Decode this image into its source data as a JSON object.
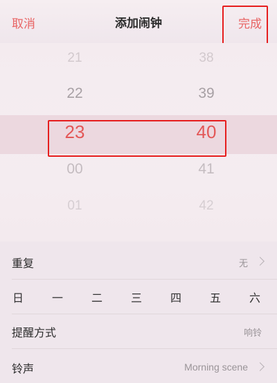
{
  "header": {
    "cancel_label": "取消",
    "title": "添加闹钟",
    "done_label": "完成"
  },
  "picker": {
    "hours": [
      "21",
      "22",
      "23",
      "00",
      "01"
    ],
    "minutes": [
      "38",
      "39",
      "40",
      "41",
      "42"
    ],
    "selected_hour": "23",
    "selected_minute": "40"
  },
  "settings": {
    "repeat": {
      "label": "重复",
      "value": "无"
    },
    "days": [
      "日",
      "一",
      "二",
      "三",
      "四",
      "五",
      "六"
    ],
    "reminder": {
      "label": "提醒方式",
      "value": "响铃"
    },
    "ringtone": {
      "label": "铃声",
      "value": "Morning scene"
    }
  },
  "colors": {
    "accent": "#e86464",
    "highlight_box": "#e61e1e"
  }
}
